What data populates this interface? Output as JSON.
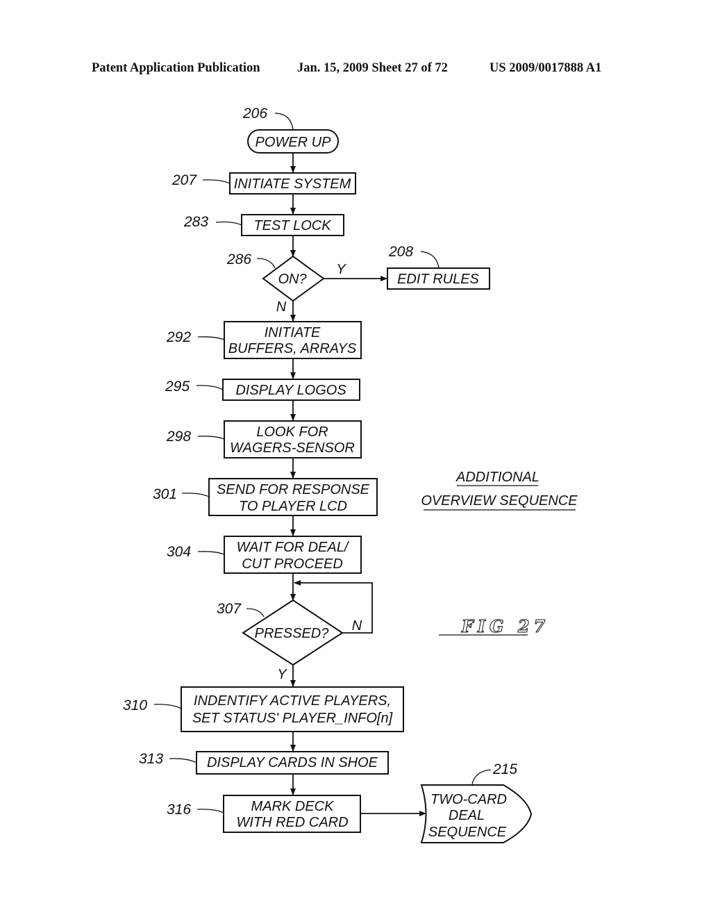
{
  "header": {
    "publication": "Patent Application Publication",
    "date_sheet": "Jan. 15, 2009  Sheet 27 of 72",
    "number": "US 2009/0017888 A1"
  },
  "diagram": {
    "title_line1": "ADDITIONAL",
    "title_line2": "OVERVIEW SEQUENCE",
    "figure_label": "FIG 27",
    "nodes": {
      "power_up": {
        "ref": "206",
        "lines": [
          "POWER UP"
        ]
      },
      "initiate_system": {
        "ref": "207",
        "lines": [
          "INITIATE SYSTEM"
        ]
      },
      "test_lock": {
        "ref": "283",
        "lines": [
          "TEST LOCK"
        ]
      },
      "on_decision": {
        "ref": "286",
        "lines": [
          "ON?"
        ]
      },
      "edit_rules": {
        "ref": "208",
        "lines": [
          "EDIT RULES"
        ]
      },
      "initiate_buffers": {
        "ref": "292",
        "lines": [
          "INITIATE",
          "BUFFERS, ARRAYS"
        ]
      },
      "display_logos": {
        "ref": "295",
        "lines": [
          "DISPLAY LOGOS"
        ]
      },
      "look_for_wagers": {
        "ref": "298",
        "lines": [
          "LOOK FOR",
          "WAGERS-SENSOR"
        ]
      },
      "send_for_response": {
        "ref": "301",
        "lines": [
          "SEND FOR RESPONSE",
          "TO PLAYER LCD"
        ]
      },
      "wait_for_deal": {
        "ref": "304",
        "lines": [
          "WAIT FOR DEAL/",
          "CUT PROCEED"
        ]
      },
      "pressed_decision": {
        "ref": "307",
        "lines": [
          "PRESSED?"
        ]
      },
      "identify_players": {
        "ref": "310",
        "lines": [
          "INDENTIFY ACTIVE PLAYERS,",
          "SET STATUS' PLAYER_INFO[n]"
        ]
      },
      "display_cards": {
        "ref": "313",
        "lines": [
          "DISPLAY CARDS IN SHOE"
        ]
      },
      "mark_deck": {
        "ref": "316",
        "lines": [
          "MARK DECK",
          "WITH RED CARD"
        ]
      },
      "two_card_deal": {
        "ref": "215",
        "lines": [
          "TWO-CARD",
          "DEAL",
          "SEQUENCE"
        ]
      }
    },
    "branch_labels": {
      "on_yes": "Y",
      "on_no": "N",
      "pressed_no": "N",
      "pressed_yes": "Y"
    }
  }
}
